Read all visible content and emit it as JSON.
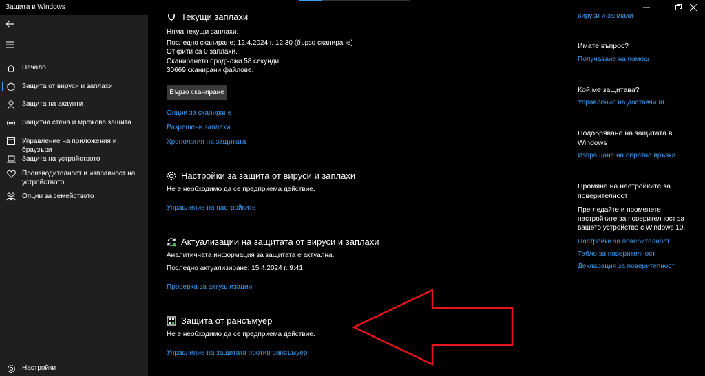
{
  "window": {
    "title": "Защита в Windows"
  },
  "sidebar": {
    "items": [
      {
        "label": "Начало",
        "icon": "home-icon"
      },
      {
        "label": "Защита от вируси и заплахи",
        "icon": "shield-icon"
      },
      {
        "label": "Защита на акаунти",
        "icon": "person-icon"
      },
      {
        "label": "Защитна стена и мрежова защита",
        "icon": "wifi-icon"
      },
      {
        "label": "Управление на приложения и браузъри",
        "icon": "app-browser-icon"
      },
      {
        "label": "Защита на устройството",
        "icon": "laptop-icon"
      },
      {
        "label": "Производителност и изправност на устройството",
        "icon": "heart-icon"
      },
      {
        "label": "Опции за семейството",
        "icon": "family-icon"
      }
    ],
    "settings_label": "Настройки"
  },
  "threats": {
    "title": "Текущи заплахи",
    "lines": [
      "Няма текущи заплахи.",
      "Последно сканиране: 12.4.2024 г. 12:30 (бързо сканиране)",
      "Открити са 0 заплахи.",
      "Сканирането продължи 58 секунди",
      "30669 сканирани файлове."
    ],
    "quick_scan_label": "Бързо сканиране",
    "links": [
      "Опции за сканиране",
      "Разрешени заплахи",
      "Хронология на защитата"
    ]
  },
  "settings_section": {
    "title": "Настройки за защита от вируси и заплахи",
    "status": "Не е необходимо да се предприема действие.",
    "link": "Управление на настройките"
  },
  "updates_section": {
    "title": "Актуализации на защитата от вируси и заплахи",
    "line1": "Аналитичната информация за защитата е актуална.",
    "line2": "Последно актуализиране: 15.4.2024 г. 9:41",
    "link": "Проверка за актуализации"
  },
  "ransomware_section": {
    "title": "Защита от рансъмуер",
    "status": "Не е необходимо да се предприема действие.",
    "link": "Управление на защитата против рансъмуер"
  },
  "right_panel": {
    "top_link": "вируси и заплахи",
    "question_title": "Имате въпрос?",
    "help_link": "Получаване на помощ",
    "who_title": "Кой ме защитава?",
    "providers_link": "Управление на доставчици",
    "improve_title": "Подобряване на защитата в Windows",
    "feedback_link": "Изпращане на обратна връзка",
    "privacy_title": "Промяна на настройките за поверителност",
    "privacy_text": "Прегледайте и променете настройките за поверителност за вашето устройство с Windows 10.",
    "privacy_links": [
      "Настройки за поверителност",
      "Табло за поверителност",
      "Декларация за поверителност"
    ]
  },
  "colors": {
    "accent": "#3b9cf0",
    "sidebar_bg": "#1f1f1f",
    "annotation_arrow": "#e8141c"
  }
}
